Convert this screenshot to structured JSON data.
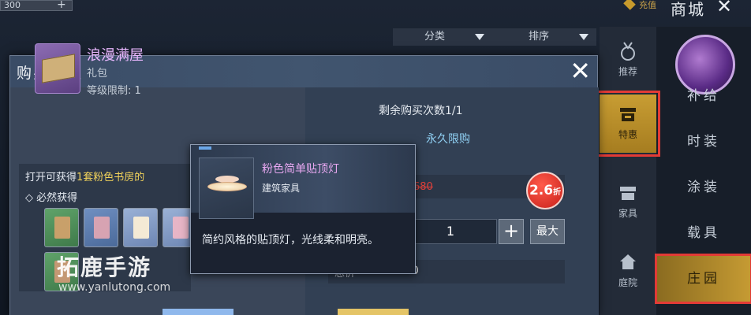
{
  "topbar": {
    "input_value": "300",
    "plus": "+",
    "recharge_label": "充值",
    "shop_title": "商城",
    "close": "✕"
  },
  "filters": [
    {
      "label": "分类"
    },
    {
      "label": "排序"
    }
  ],
  "sidebar": {
    "items": [
      {
        "label": "推荐",
        "icon": "medal-icon"
      },
      {
        "label": "特惠",
        "icon": "shop-icon",
        "active": true
      },
      {
        "label": "家具",
        "icon": "furniture-icon"
      },
      {
        "label": "庭院",
        "icon": "house-icon"
      }
    ]
  },
  "categories": [
    {
      "label": "补给"
    },
    {
      "label": "时装"
    },
    {
      "label": "涂装"
    },
    {
      "label": "载具"
    },
    {
      "label": "庄园",
      "active": true
    }
  ],
  "dialog": {
    "title": "购买确认",
    "item": {
      "name": "浪漫满屋",
      "type": "礼包",
      "level": "等级限制: 1"
    },
    "remaining": "剩余购买次数1/1",
    "limit": "永久限购",
    "content_prefix": "打开可获得",
    "content_highlight": "1套粉色书房的",
    "must_get": "◇ 必然获得",
    "old_price": "680",
    "discount": "2.6",
    "discount_suffix": "折",
    "quantity": "1",
    "plus": "+",
    "max": "最大",
    "total_label": "总价",
    "total_value": "180"
  },
  "tooltip": {
    "name": "粉色简单贴顶灯",
    "category": "建筑家具",
    "description": "简约风格的贴顶灯，光线柔和明亮。"
  },
  "watermark": {
    "text": "拓鹿手游",
    "url": "www.yanlutong.com"
  },
  "colors": {
    "accent_gold": "#c89d33",
    "highlight_red": "#e23b36",
    "item_purple": "#e9b7ff",
    "limit_blue": "#8fcff2",
    "discount_red": "#c8201a"
  }
}
